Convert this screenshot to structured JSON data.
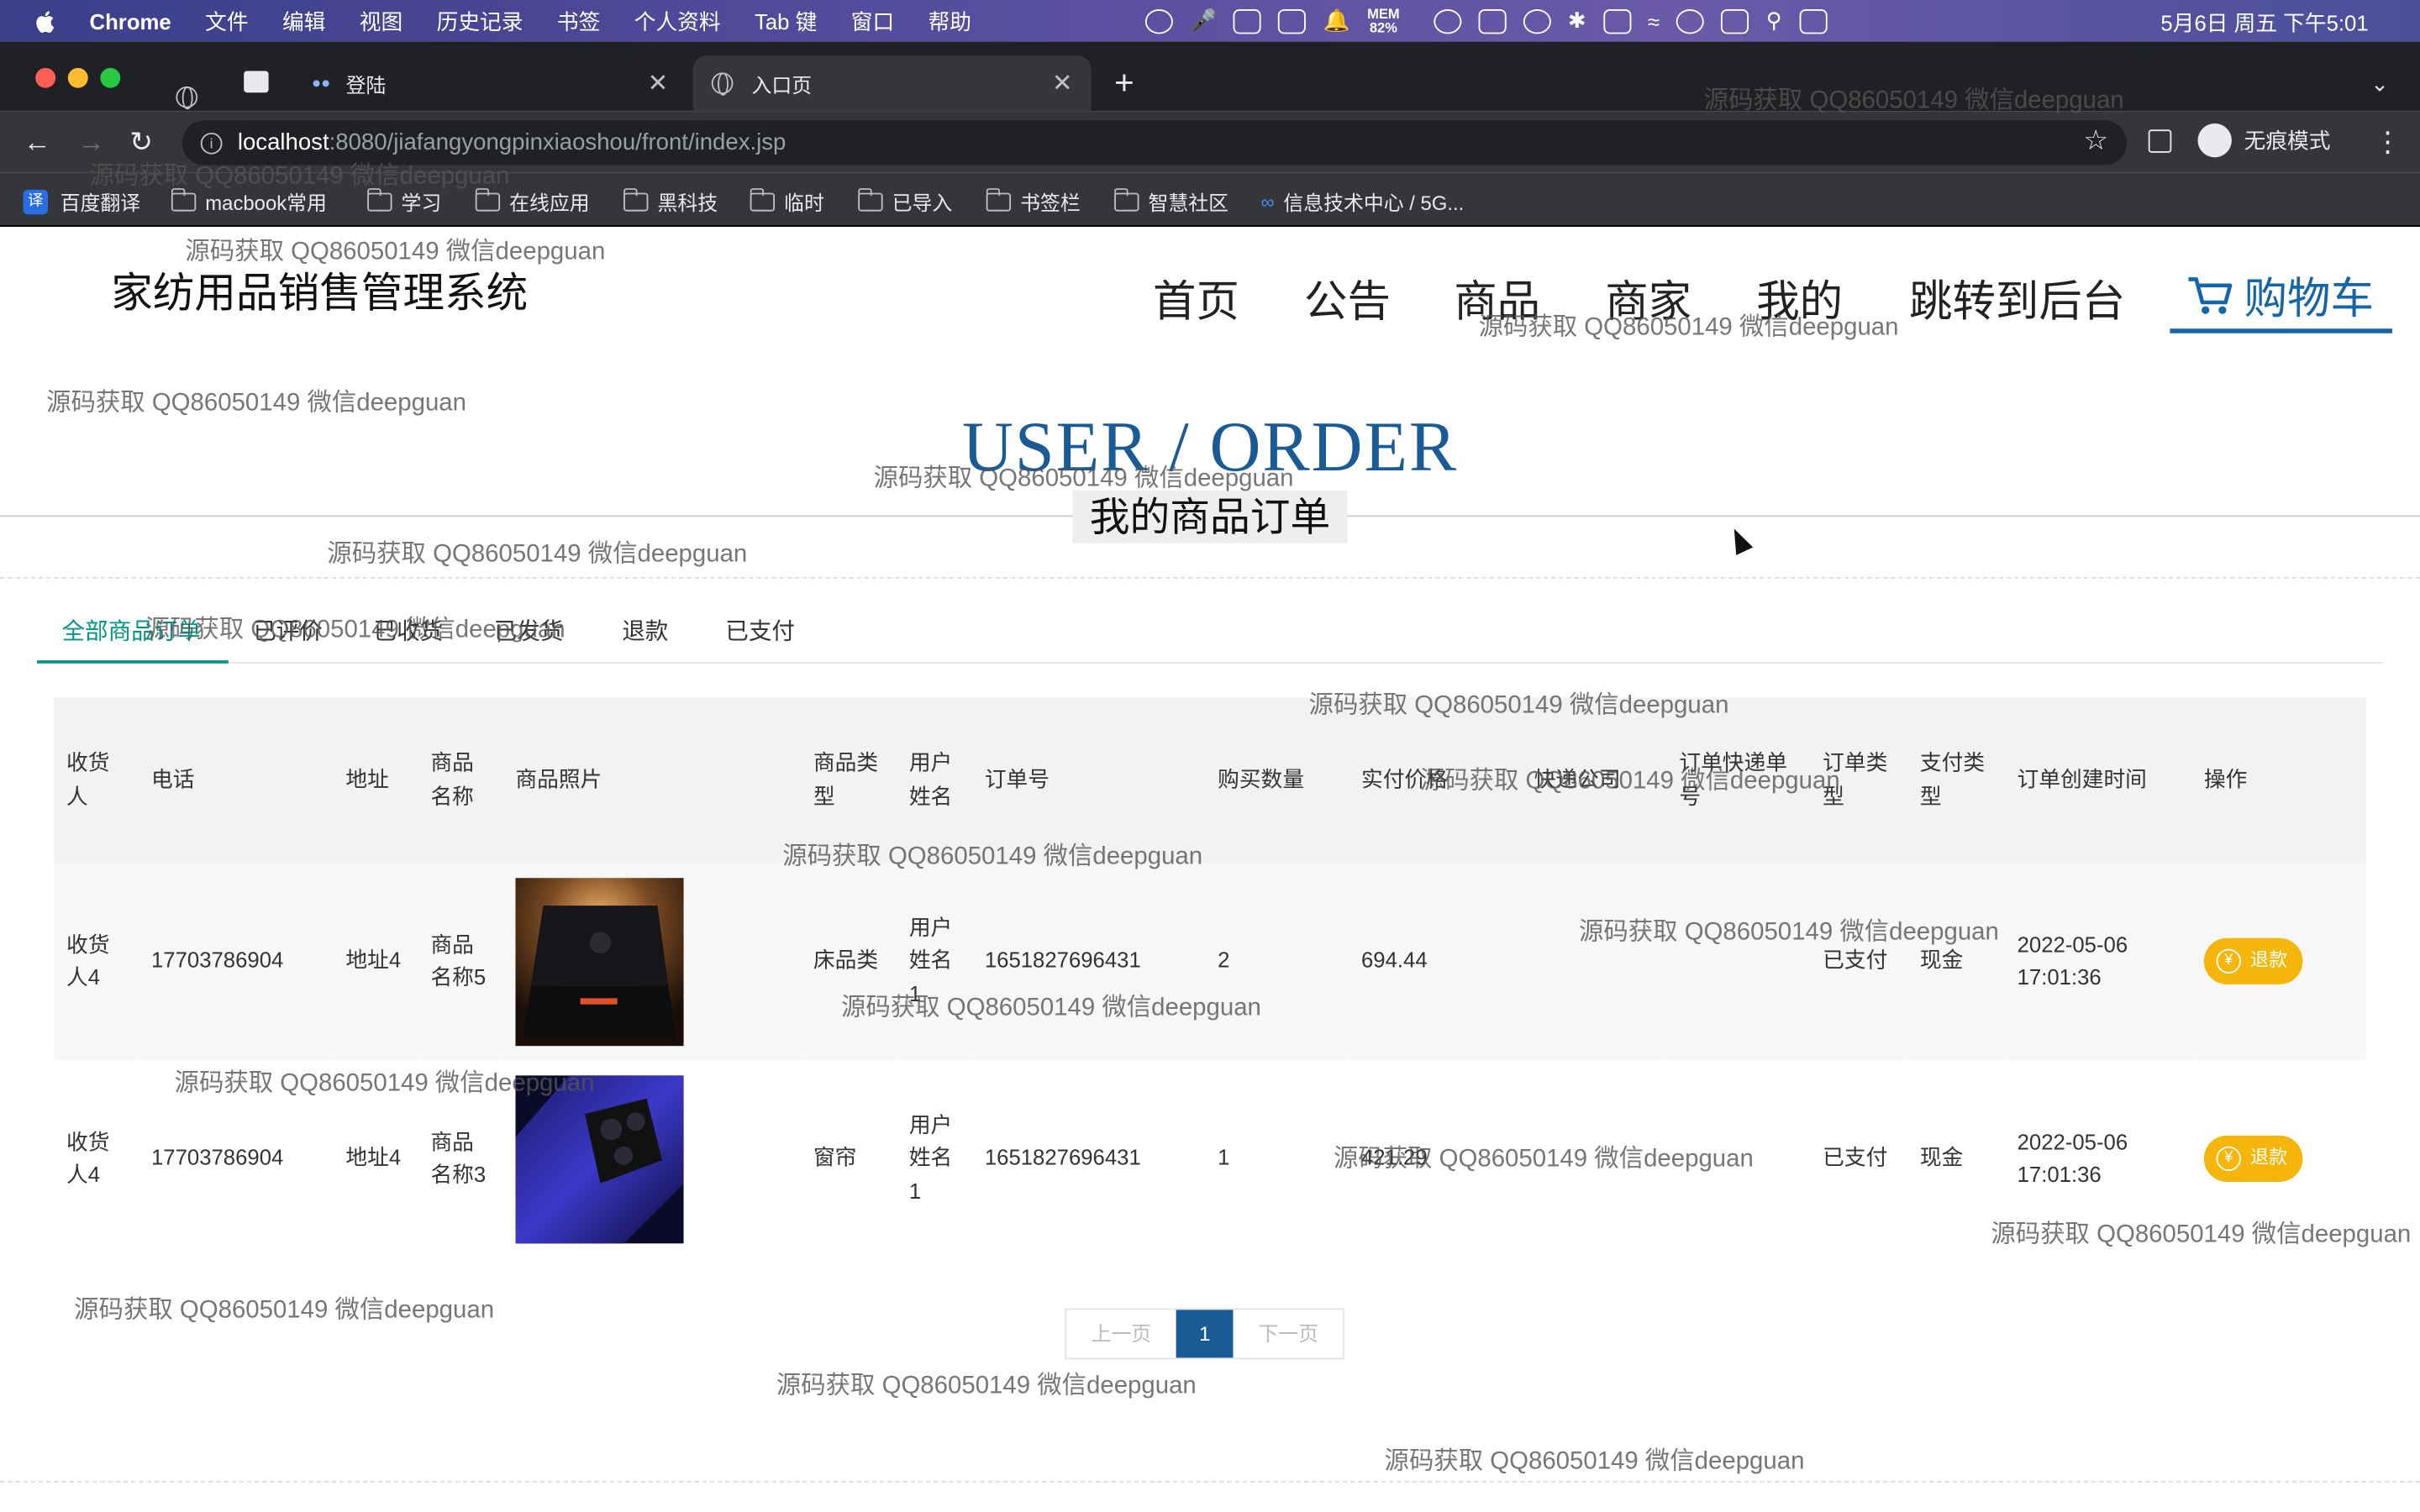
{
  "menubar": {
    "app": "Chrome",
    "items": [
      "文件",
      "编辑",
      "视图",
      "历史记录",
      "书签",
      "个人资料",
      "Tab 键",
      "窗口",
      "帮助"
    ],
    "mem": "MEM",
    "mem_pct": "82%",
    "clock": "5月6日 周五 下午5:01"
  },
  "browser": {
    "tabs": [
      {
        "label": "登陆"
      },
      {
        "label": "入口页"
      }
    ],
    "new_tab": "+",
    "url_host": "localhost",
    "url_path": ":8080/jiafangyongpinxiaoshou/front/index.jsp",
    "incognito": "无痕模式",
    "bookmarks": [
      "百度翻译",
      "macbook常用",
      "学习",
      "在线应用",
      "黑科技",
      "临时",
      "已导入",
      "书签栏",
      "智慧社区",
      "信息技术中心 / 5G..."
    ]
  },
  "site": {
    "title": "家纺用品销售管理系统",
    "nav": [
      "首页",
      "公告",
      "商品",
      "商家",
      "我的",
      "跳转到后台"
    ],
    "cart": "购物车"
  },
  "hero": {
    "en": "USER / ORDER",
    "cn": "我的商品订单"
  },
  "order_tabs": [
    "全部商品订单",
    "已评价",
    "已收货",
    "已发货",
    "退款",
    "已支付"
  ],
  "table": {
    "headers": [
      "收货人",
      "电话",
      "地址",
      "商品名称",
      "商品照片",
      "商品类型",
      "用户姓名",
      "订单号",
      "购买数量",
      "实付价格",
      "快递公司",
      "订单快递单号",
      "订单类型",
      "支付类型",
      "订单创建时间",
      "操作"
    ],
    "rows": [
      {
        "receiver": "收货人4",
        "phone": "17703786904",
        "address": "地址4",
        "product": "商品名称5",
        "category": "床品类",
        "user": "用户姓名1",
        "order_no": "1651827696431",
        "qty": "2",
        "price": "694.44",
        "express": "",
        "tracking": "",
        "order_type": "已支付",
        "pay_type": "现金",
        "created": "2022-05-06 17:01:36",
        "action": "退款",
        "photo": "laptop"
      },
      {
        "receiver": "收货人4",
        "phone": "17703786904",
        "address": "地址4",
        "product": "商品名称3",
        "category": "窗帘",
        "user": "用户姓名1",
        "order_no": "1651827696431",
        "qty": "1",
        "price": "421.29",
        "express": "",
        "tracking": "",
        "order_type": "已支付",
        "pay_type": "现金",
        "created": "2022-05-06 17:01:36",
        "action": "退款",
        "photo": "phone"
      }
    ]
  },
  "pager": {
    "prev": "上一页",
    "current": "1",
    "next": "下一页"
  },
  "watermark": "源码获取 QQ86050149 微信deepguan",
  "colors": {
    "accent": "#1a5b95",
    "tab_active": "#009688",
    "refund": "#f5b50a"
  }
}
